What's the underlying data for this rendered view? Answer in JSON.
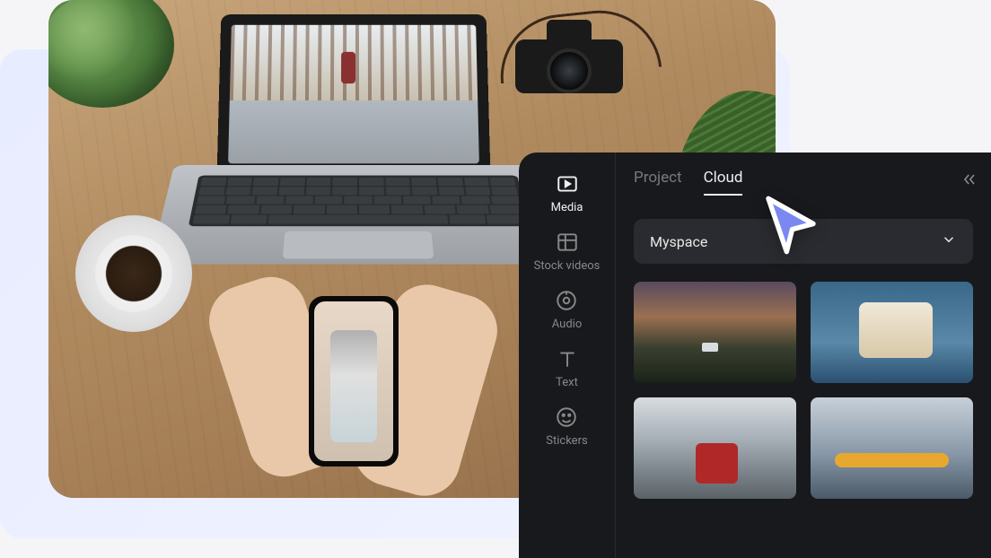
{
  "sidebar": {
    "items": [
      {
        "label": "Media",
        "icon": "media-icon"
      },
      {
        "label": "Stock videos",
        "icon": "stock-icon"
      },
      {
        "label": "Audio",
        "icon": "audio-icon"
      },
      {
        "label": "Text",
        "icon": "text-icon"
      },
      {
        "label": "Stickers",
        "icon": "stickers-icon"
      }
    ]
  },
  "tabs": {
    "project": "Project",
    "cloud": "Cloud",
    "active": "cloud"
  },
  "dropdown": {
    "selected": "Myspace"
  },
  "thumbnails": [
    {
      "name": "sunset-landscape"
    },
    {
      "name": "woman-canoe"
    },
    {
      "name": "winter-paddler"
    },
    {
      "name": "kayak-lake"
    }
  ],
  "colors": {
    "cursor": "#7b88f0",
    "cursor_outline": "#ffffff"
  }
}
